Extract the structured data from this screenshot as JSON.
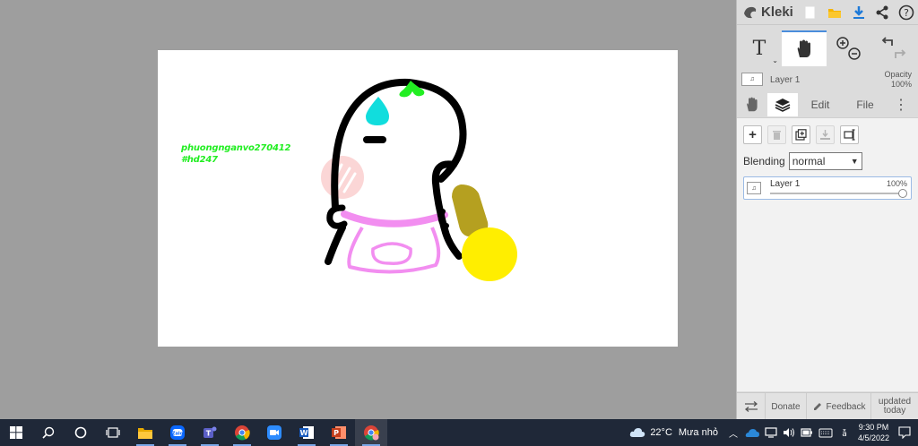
{
  "app": {
    "name": "Kleki"
  },
  "canvas_text": {
    "line1": "phuongnganvo270412",
    "line2": "#hd247"
  },
  "toolbar": {
    "text_tool": "T"
  },
  "layer_info": {
    "layer_name": "Layer 1",
    "opacity_label": "Opacity",
    "opacity_value": "100%"
  },
  "tabs": [
    {
      "label": "Edit"
    },
    {
      "label": "File"
    }
  ],
  "layers_panel": {
    "blending_label": "Blending",
    "blending_value": "normal",
    "layers": [
      {
        "name": "Layer 1",
        "opacity": "100%"
      }
    ]
  },
  "bottom_bar": {
    "donate": "Donate",
    "feedback": "Feedback",
    "updated_line1": "updated",
    "updated_line2": "today"
  },
  "taskbar": {
    "apps": [
      "windows-start",
      "search",
      "cortana",
      "task-view",
      "file-explorer",
      "zalo",
      "teams",
      "chrome",
      "zoom",
      "word",
      "powerpoint",
      "chrome-paint"
    ],
    "weather_temp": "22°C",
    "weather_text": "Mưa nhỏ",
    "time": "9:30 PM",
    "date": "4/5/2022"
  },
  "colors": {
    "canvas_bg": "#ffffff",
    "workspace_bg": "#9e9e9e",
    "panel_bg": "#dcdcdc",
    "accent": "#4a8ddc",
    "taskbar_bg": "#1f2838",
    "drawing_green": "#22ee22",
    "drawing_cyan": "#11dddd",
    "drawing_pink": "#f28ef0",
    "drawing_yellow": "#ffee00",
    "drawing_olive": "#b5a020"
  }
}
